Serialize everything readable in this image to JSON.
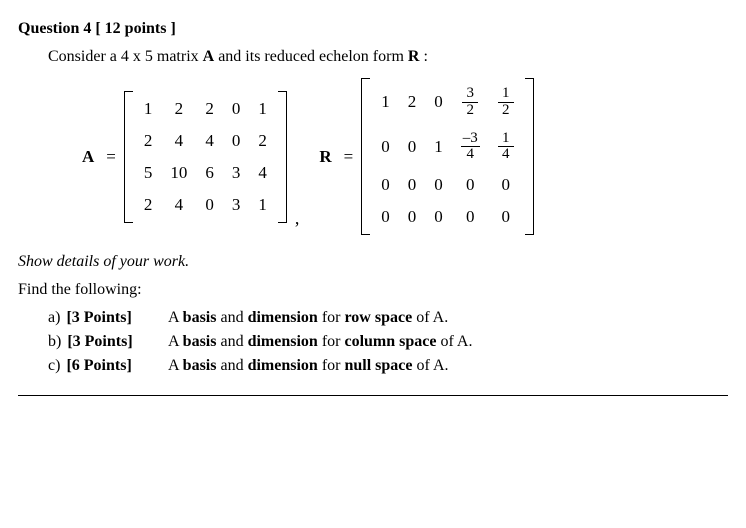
{
  "heading": "Question 4  [ 12  points ]",
  "intro_pre": "Consider a 4 x 5 matrix ",
  "intro_A": "A",
  "intro_mid": " and its reduced echelon form ",
  "intro_R": "R",
  "intro_post": " :",
  "label_A": "A",
  "eqsym_A": "=",
  "matrix_A": [
    [
      "1",
      "2",
      "2",
      "0",
      "1"
    ],
    [
      "2",
      "4",
      "4",
      "0",
      "2"
    ],
    [
      "5",
      "10",
      "6",
      "3",
      "4"
    ],
    [
      "2",
      "4",
      "0",
      "3",
      "1"
    ]
  ],
  "comma": ",",
  "label_R": "R",
  "eqsym_R": "=",
  "matrix_R": [
    [
      "1",
      "2",
      "0",
      {
        "frac": {
          "num": "3",
          "den": "2"
        }
      },
      {
        "frac": {
          "num": "1",
          "den": "2"
        }
      }
    ],
    [
      "0",
      "0",
      "1",
      {
        "frac": {
          "num": "–3",
          "den": "4"
        }
      },
      {
        "frac": {
          "num": "1",
          "den": "4"
        }
      }
    ],
    [
      "0",
      "0",
      "0",
      "0",
      "0"
    ],
    [
      "0",
      "0",
      "0",
      "0",
      "0"
    ]
  ],
  "show_details": "Show details of your work.",
  "find_heading": "Find the following:",
  "parts": [
    {
      "letter": "a)",
      "points": "[3 Points]",
      "pre": "A ",
      "b1": "basis",
      "mid1": " and ",
      "b2": "dimension",
      "mid2": " for ",
      "b3": "row space",
      "post": " of A."
    },
    {
      "letter": "b)",
      "points": "[3 Points]",
      "pre": "A ",
      "b1": "basis",
      "mid1": " and ",
      "b2": "dimension",
      "mid2": " for ",
      "b3": "column space",
      "post": " of A."
    },
    {
      "letter": "c)",
      "points": "[6 Points]",
      "pre": "A ",
      "b1": "basis",
      "mid1": " and ",
      "b2": "dimension",
      "mid2": " for ",
      "b3": "null space",
      "post": " of A."
    }
  ]
}
